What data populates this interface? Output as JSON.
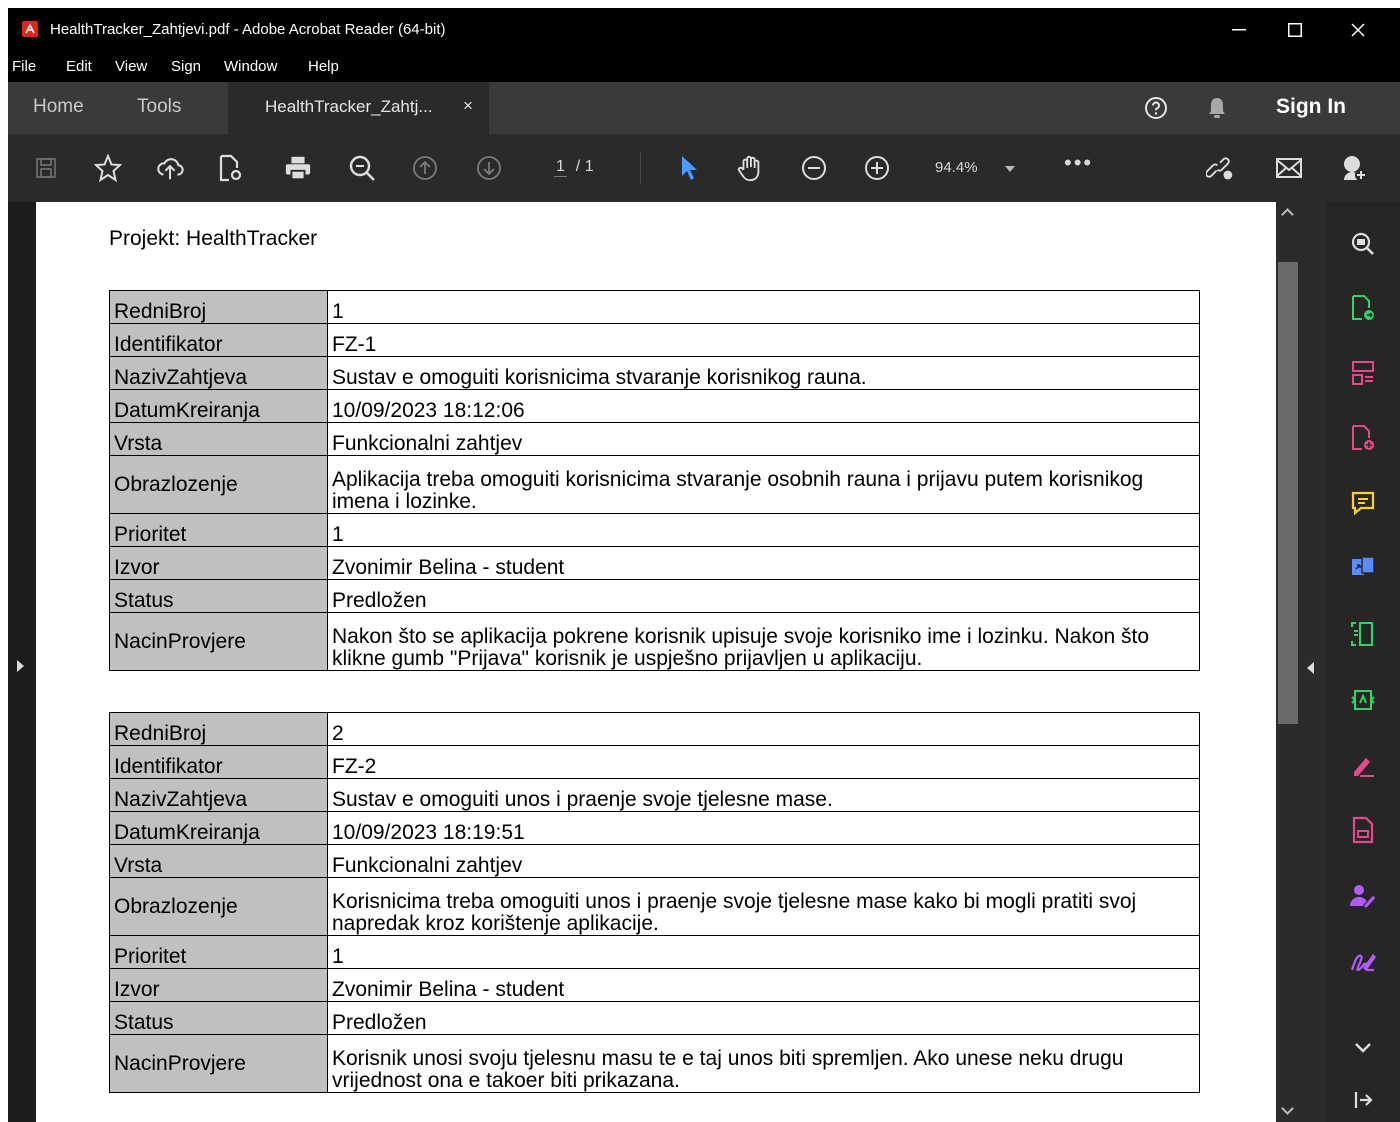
{
  "window": {
    "title": "HealthTracker_Zahtjevi.pdf - Adobe Acrobat Reader (64-bit)",
    "controls": [
      "minimize-icon",
      "maximize-icon",
      "close-icon"
    ]
  },
  "menu": [
    "File",
    "Edit",
    "View",
    "Sign",
    "Window",
    "Help"
  ],
  "tabs": {
    "home": "Home",
    "tools": "Tools",
    "document": "HealthTracker_Zahtj...",
    "close_glyph": "×",
    "sign_in": "Sign In"
  },
  "toolbar": {
    "page_current": "1",
    "page_total": "/ 1",
    "zoom": "94.4%",
    "more": "•••",
    "icons": [
      "save-icon",
      "bookmark-star-icon",
      "cloud-upload-icon",
      "file-settings-icon",
      "print-icon",
      "zoom-search-icon",
      "page-up-icon",
      "page-down-icon",
      "select-cursor-icon",
      "hand-icon",
      "zoom-out-icon",
      "zoom-in-icon",
      "share-link-icon",
      "email-icon",
      "account-add-icon"
    ]
  },
  "right_panel": {
    "icons": [
      "zoom-panel-icon",
      "export-pdf-icon",
      "organize-pages-icon",
      "create-pdf-icon",
      "comment-icon",
      "combine-files-icon",
      "scan-ocr-icon",
      "convert-pdf-icon",
      "edit-sign-icon",
      "document-icon",
      "request-signature-icon",
      "fill-sign-icon",
      "more-tools-chevron-icon",
      "collapse-panel-icon"
    ],
    "colors": {
      "green": "#2fd566",
      "magenta": "#e9478c",
      "yellow": "#ffd21f",
      "purple": "#b45bff"
    }
  },
  "document": {
    "project_title": "Projekt: HealthTracker",
    "requirements": [
      {
        "rows": [
          {
            "key": "RedniBroj",
            "value": "1"
          },
          {
            "key": "Identifikator",
            "value": "FZ-1"
          },
          {
            "key": "NazivZahtjeva",
            "value": "Sustav e omoguiti korisnicima stvaranje korisnikog rauna."
          },
          {
            "key": "DatumKreiranja",
            "value": "10/09/2023 18:12:06"
          },
          {
            "key": "Vrsta",
            "value": "Funkcionalni zahtjev"
          },
          {
            "key": "Obrazlozenje",
            "value": "Aplikacija treba omoguiti korisnicima stvaranje osobnih rauna i prijavu putem korisnikog imena i lozinke."
          },
          {
            "key": "Prioritet",
            "value": "1"
          },
          {
            "key": "Izvor",
            "value": "Zvonimir Belina - student"
          },
          {
            "key": "Status",
            "value": "Predložen"
          },
          {
            "key": "NacinProvjere",
            "value": "Nakon što se aplikacija pokrene korisnik upisuje svoje korisniko ime i lozinku. Nakon što klikne gumb \"Prijava\" korisnik je uspješno prijavljen u aplikaciju."
          }
        ]
      },
      {
        "rows": [
          {
            "key": "RedniBroj",
            "value": "2"
          },
          {
            "key": "Identifikator",
            "value": "FZ-2"
          },
          {
            "key": "NazivZahtjeva",
            "value": "Sustav e omoguiti unos i praenje svoje tjelesne mase."
          },
          {
            "key": "DatumKreiranja",
            "value": "10/09/2023 18:19:51"
          },
          {
            "key": "Vrsta",
            "value": "Funkcionalni zahtjev"
          },
          {
            "key": "Obrazlozenje",
            "value": "Korisnicima treba omoguiti unos i praenje svoje tjelesne mase kako bi mogli pratiti svoj napredak kroz korištenje aplikacije."
          },
          {
            "key": "Prioritet",
            "value": "1"
          },
          {
            "key": "Izvor",
            "value": "Zvonimir Belina - student"
          },
          {
            "key": "Status",
            "value": "Predložen"
          },
          {
            "key": "NacinProvjere",
            "value": "Korisnik unosi svoju tjelesnu masu te e taj unos biti spremljen. Ako unese neku drugu vrijednost ona e takoer biti prikazana."
          }
        ]
      }
    ]
  }
}
